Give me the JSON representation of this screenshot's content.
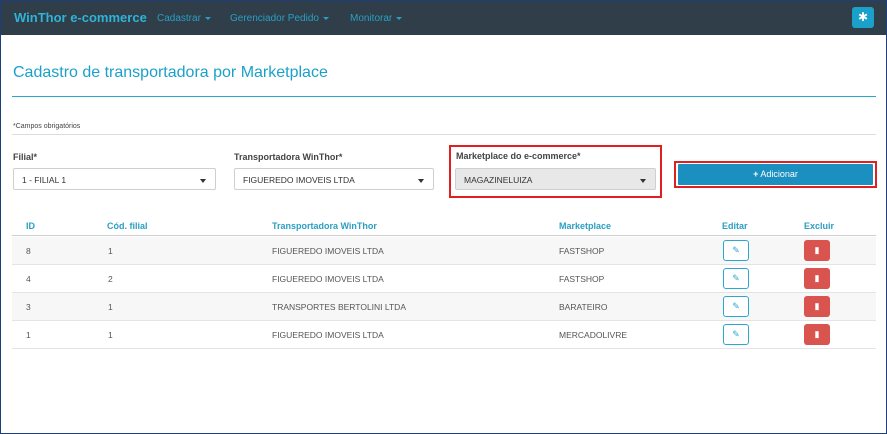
{
  "navbar": {
    "brand": "WinThor e-commerce",
    "items": [
      {
        "label": "Cadastrar"
      },
      {
        "label": "Gerenciador Pedido"
      },
      {
        "label": "Monitorar"
      }
    ],
    "settings_icon": "gear-icon"
  },
  "page": {
    "title": "Cadastro de transportadora por Marketplace",
    "required_note": "*Campos obrigatórios"
  },
  "form": {
    "filial": {
      "label": "Filial*",
      "value": "1 - FILIAL 1"
    },
    "transportadora": {
      "label": "Transportadora WinThor*",
      "value": "FIGUEREDO IMOVEIS LTDA"
    },
    "marketplace": {
      "label": "Marketplace do e-commerce*",
      "value": "MAGAZINELUIZA"
    },
    "add_button": {
      "icon": "+",
      "label": "Adicionar"
    }
  },
  "table": {
    "headers": [
      "ID",
      "Cód. filial",
      "Transportadora WinThor",
      "Marketplace",
      "Editar",
      "Excluir"
    ],
    "rows": [
      {
        "id": "8",
        "filial": "1",
        "transportadora": "FIGUEREDO IMOVEIS LTDA",
        "marketplace": "FASTSHOP"
      },
      {
        "id": "4",
        "filial": "2",
        "transportadora": "FIGUEREDO IMOVEIS LTDA",
        "marketplace": "FASTSHOP"
      },
      {
        "id": "3",
        "filial": "1",
        "transportadora": "TRANSPORTES BERTOLINI LTDA",
        "marketplace": "BARATEIRO"
      },
      {
        "id": "1",
        "filial": "1",
        "transportadora": "FIGUEREDO IMOVEIS LTDA",
        "marketplace": "MERCADOLIVRE"
      }
    ]
  },
  "colors": {
    "navbar_bg": "#2f3e48",
    "accent": "#1ba1c9",
    "highlight": "#e02020",
    "delete": "#d9534f"
  }
}
